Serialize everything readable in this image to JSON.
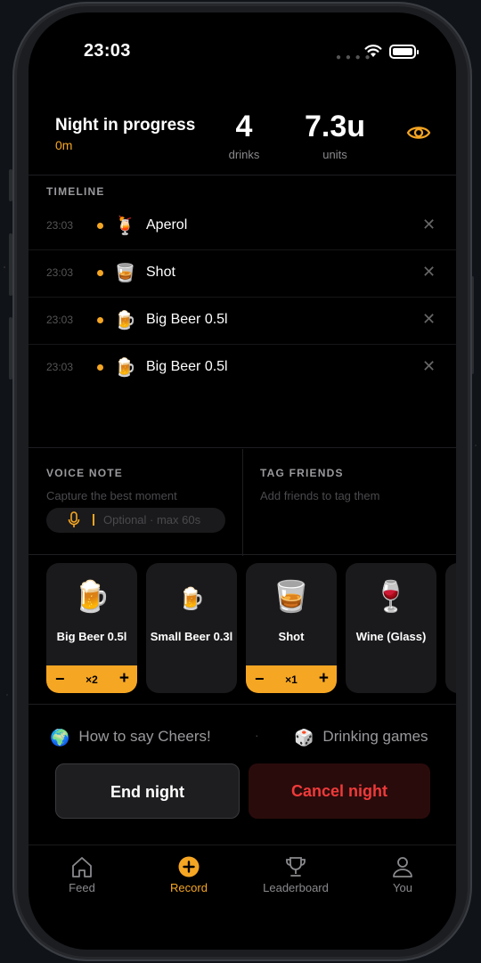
{
  "status_bar": {
    "time": "23:03"
  },
  "header": {
    "title": "Night in progress",
    "duration": "0m",
    "drinks_value": "4",
    "drinks_label": "drinks",
    "units_value": "7.3u",
    "units_label": "units"
  },
  "timeline": {
    "label": "TIMELINE",
    "items": [
      {
        "time": "23:03",
        "icon": "🍹",
        "name": "Aperol"
      },
      {
        "time": "23:03",
        "icon": "🥃",
        "name": "Shot"
      },
      {
        "time": "23:03",
        "icon": "🍺",
        "name": "Big Beer 0.5l"
      },
      {
        "time": "23:03",
        "icon": "🍺",
        "name": "Big Beer 0.5l"
      }
    ]
  },
  "voice_note": {
    "label": "VOICE NOTE",
    "subtitle": "Capture the best moment",
    "placeholder": "Optional · max 60s"
  },
  "tag_friends": {
    "label": "TAG FRIENDS",
    "subtitle": "Add friends to tag them"
  },
  "drinks": [
    {
      "icon": "🍺",
      "name": "Big Beer 0.5l",
      "count": "×2",
      "selected": true
    },
    {
      "icon": "🍺",
      "name": "Small Beer 0.3l",
      "count": "",
      "selected": false
    },
    {
      "icon": "🥃",
      "name": "Shot",
      "count": "×1",
      "selected": true
    },
    {
      "icon": "🍷",
      "name": "Wine (Glass)",
      "count": "",
      "selected": false
    }
  ],
  "links": {
    "cheers_icon": "🌍",
    "cheers": "How to say Cheers!",
    "games_icon": "🎲",
    "games": "Drinking games"
  },
  "actions": {
    "end": "End night",
    "cancel": "Cancel night"
  },
  "tabs": [
    {
      "label": "Feed",
      "icon": "home-icon"
    },
    {
      "label": "Record",
      "icon": "plus-circle-icon",
      "active": true
    },
    {
      "label": "Leaderboard",
      "icon": "trophy-icon"
    },
    {
      "label": "You",
      "icon": "person-icon"
    }
  ],
  "colors": {
    "accent": "#f5a623",
    "danger": "#f03a3a",
    "background": "#000000"
  }
}
